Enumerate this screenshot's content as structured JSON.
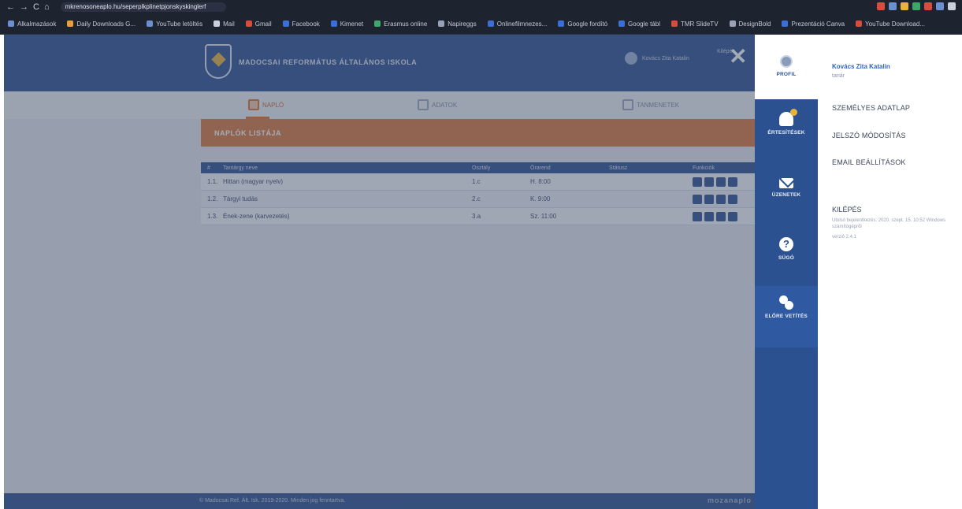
{
  "browser": {
    "url": "mkrenosoneaplo.hu/seperplkplinetpjonskyskinglerf",
    "nav_back": "←",
    "nav_forward": "→",
    "nav_reload": "C",
    "nav_home": "⌂",
    "bookmarks": [
      {
        "label": "Alkalmazások",
        "color": "#6c8fd1"
      },
      {
        "label": "Daily Downloads G...",
        "color": "#e8a03a"
      },
      {
        "label": "YouTube letöltés",
        "color": "#6c8fd1"
      },
      {
        "label": "Mail",
        "color": "#c9cfdc"
      },
      {
        "label": "Gmail",
        "color": "#d94c3d"
      },
      {
        "label": "Facebook",
        "color": "#3b6fd6"
      },
      {
        "label": "Kimenet",
        "color": "#3b6fd6"
      },
      {
        "label": "Erasmus online",
        "color": "#3fa66a"
      },
      {
        "label": "Napireggs",
        "color": "#9aa3b5"
      },
      {
        "label": "Onlinefilmnezes...",
        "color": "#3b6fd6"
      },
      {
        "label": "Google fordító",
        "color": "#3b6fd6"
      },
      {
        "label": "Google tábl",
        "color": "#3b6fd6"
      },
      {
        "label": "TMR SlideTV",
        "color": "#d94c3d"
      },
      {
        "label": "DesignBold",
        "color": "#9aa3b5"
      },
      {
        "label": "Prezentáció Canva",
        "color": "#3b6fd6"
      },
      {
        "label": "YouTube Download...",
        "color": "#d94c3d"
      }
    ],
    "extension_colors": [
      "#d94c3d",
      "#6c8fd1",
      "#e8b33a",
      "#3fa66a",
      "#d94c3d",
      "#6c8fd1",
      "#c9cfdc"
    ]
  },
  "app": {
    "school_name": "MADOCSAI REFORMÁTUS ÁLTALÁNOS ISKOLA",
    "user_chip": "Kovács Zita Katalin",
    "logout_small": "Kilépés",
    "close_symbol": "✕",
    "subnav": [
      {
        "label": "NAPLÓ",
        "active": true
      },
      {
        "label": "ADATOK",
        "active": false
      },
      {
        "label": "TANMENETEK",
        "active": false
      }
    ],
    "banner_title": "NAPLÓK LISTÁJA",
    "table": {
      "headers": [
        "#",
        "Tantárgy neve",
        "Osztály",
        "Órarend",
        "Státusz",
        "Funkciók"
      ],
      "rows": [
        {
          "no": "1.1.",
          "name": "Hittan (magyar nyelv)",
          "group": "1.c",
          "time": "H. 8:00"
        },
        {
          "no": "1.2.",
          "name": "Tárgyi tudás",
          "group": "2.c",
          "time": "K. 9:00"
        },
        {
          "no": "1.3.",
          "name": "Ének-zene (karvezetés)",
          "group": "3.a",
          "time": "Sz. 11:00"
        }
      ]
    },
    "footer_text": "© Madocsai Ref. Ált. Isk. 2019-2020. Minden jog fenntartva.",
    "footer_brand": "mozanaplo"
  },
  "rail": [
    {
      "label": "PROFIL",
      "icon": "avatar-icon"
    },
    {
      "label": "ÉRTESÍTÉSEK",
      "icon": "bell-icon"
    },
    {
      "label": "ÜZENETEK",
      "icon": "mail-icon"
    },
    {
      "label": "SÚGÓ",
      "icon": "help-icon"
    },
    {
      "label": "ELŐRE VETÍTÉS",
      "icon": "gear-icon"
    }
  ],
  "panel": {
    "user_name": "Kovács Zita Katalin",
    "user_role": "tanár",
    "menu": [
      "SZEMÉLYES ADATLAP",
      "JELSZÓ MÓDOSÍTÁS",
      "EMAIL BEÁLLÍTÁSOK"
    ],
    "logout_title": "KILÉPÉS",
    "logout_info": "Utolsó bejelentkezés: 2020. szept. 15. 10:52 Windows számítógépről",
    "version": "verzió 2.4.1"
  }
}
